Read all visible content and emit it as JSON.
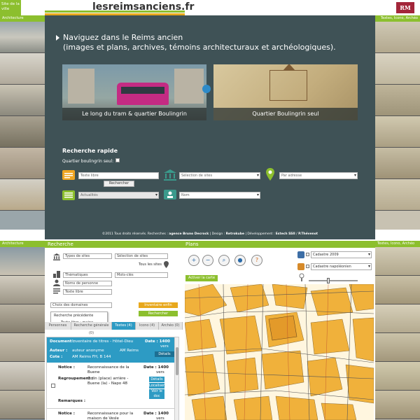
{
  "site": {
    "badge": "Site de la ville",
    "logo_text": "lesreimsanciens.fr",
    "logo_stripe_colors": [
      "#8cbf2e",
      "#e8a81c",
      "#2d9bc4"
    ],
    "partner_logo": "RM",
    "left_column_label": "Architecture",
    "right_column_label": "Textes, Icono, Archéo"
  },
  "hero": {
    "title_line1": "Naviguez dans le Reims ancien",
    "title_line2": "(images et plans, archives, témoins architecturaux et archéologiques).",
    "promo_tram_label": "Le long du tram & quartier Boulingrin",
    "promo_boulingrin_label": "Quartier Boulingrin seul"
  },
  "quick_search": {
    "title": "Recherche rapide",
    "checkbox_label": "Quartier boulingrin seul:",
    "free_text_placeholder": "Texte libre",
    "search_button": "Rechercher",
    "current_events_value": "Actualités",
    "sites_select_value": "Sélection de sites",
    "address_select_value": "Par adresse",
    "name_select_value": "Nom"
  },
  "footer": {
    "copyright": "©2011 Tous droits réservés. Recherches :",
    "agency": "agence Bruno Decrock",
    "design_label": "| Design :",
    "design_by": "Retrokube",
    "dev_label": "| Développement :",
    "dev_by": "Estech SSII",
    "and_sep": "/",
    "dev_by2": "P.Thévenot"
  },
  "search_panel": {
    "tab": "Recherche",
    "types_select": "Types de sites",
    "sites_select": "Sélection de sites",
    "all_sites_label": "Tous les sites",
    "themes_select": "Thématiques",
    "keywords_select": "Mots-clés",
    "people_select": "Noms de personne",
    "free_text_placeholder": "Texte libre",
    "domains_select": "Choix des domaines",
    "recent_search": "Recherche précédente",
    "recent_item": "Texte libre : maine",
    "save_button": "Inventaire enfin",
    "search_button": "Rechercher",
    "tabs": [
      {
        "label": "Personnes",
        "active": false
      },
      {
        "label": "Recherche générale (0)",
        "active": false
      },
      {
        "label": "Textes (4)",
        "active": true
      },
      {
        "label": "Icono (4)",
        "active": false
      },
      {
        "label": "Archéo (0)",
        "active": false
      }
    ]
  },
  "result_header": {
    "doc_key": "Document :",
    "doc_value": "Inventaire de titres - Hôtel-Dieu",
    "date_key": "Date : 1400",
    "date_value": "vers",
    "author_key": "Auteur :",
    "author_value": "auteur anonyme",
    "archive": "AM Reims",
    "cote_key": "Cote :",
    "cote_value": "AM Reims FH, B 144",
    "details_btn": "Détails"
  },
  "result_rows": [
    {
      "notice_key": "Notice :",
      "notice_value": "Reconnaissance de la Buene",
      "date_key": "Date : 1400",
      "date_value": "vers",
      "regroup_key": "Regroupement :",
      "regroup_value": "Colin (place) arrière - Buene (la) - Napo 48",
      "btn_details": "Détails",
      "btn_locate": "Localiser",
      "btn_view": "Voir le doc",
      "remarks_key": "Remarques :"
    },
    {
      "notice_key": "Notice :",
      "notice_value": "Reconnaissance pour la maison de Vesle",
      "date_key": "Date : 1400",
      "date_value": "vers"
    }
  ],
  "map_panel": {
    "tab": "Plans",
    "tools": [
      {
        "icon": "zoom-in-icon",
        "glyph": "+"
      },
      {
        "icon": "zoom-out-icon",
        "glyph": "−"
      },
      {
        "icon": "zoom-extent-icon",
        "glyph": "⌕"
      },
      {
        "icon": "people-icon",
        "glyph": "●"
      },
      {
        "icon": "help-icon",
        "glyph": "?"
      }
    ],
    "layers": [
      {
        "label": "Cadastre 2009",
        "color": "#3d6ea6"
      },
      {
        "label": "Cadastre napoléonien",
        "color": "#d68a2a"
      }
    ],
    "action_label": "Activer la carte",
    "opacity_level": 0.4
  },
  "colors": {
    "accent_green": "#8cbf2e",
    "accent_blue": "#2d9bc4",
    "hero_bg": "#3f5256",
    "map_buildings": "#f0b13b"
  }
}
